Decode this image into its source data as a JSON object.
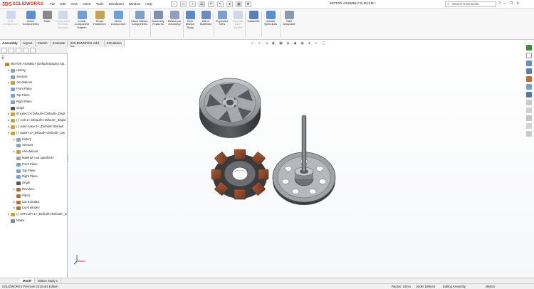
{
  "app": {
    "brand_prefix": "3DS",
    "brand": "SOLIDWORKS"
  },
  "menu": [
    "File",
    "Edit",
    "View",
    "Insert",
    "Tools",
    "Simulation",
    "Window",
    "Help"
  ],
  "document_title": "MOTOR ASSMBLY.SLDASM *",
  "search": {
    "placeholder": "Search Commands"
  },
  "ribbon": [
    {
      "label": "Edit Component",
      "disabled": true,
      "color": "#9bb6d8"
    },
    {
      "label": "Insert Components",
      "disabled": false,
      "color": "#5a8fd0"
    },
    {
      "label": "Mate",
      "disabled": false,
      "color": "#8a8a8a"
    },
    {
      "label": "Component Preview Window",
      "disabled": true,
      "color": "#9bb6d8"
    },
    {
      "label": "Linear Component Pattern",
      "disabled": false,
      "color": "#6f9fd8"
    },
    {
      "label": "Smart Fasteners",
      "disabled": false,
      "color": "#c9a25a"
    },
    {
      "label": "Move Component",
      "disabled": false,
      "color": "#6f9fd8"
    },
    {
      "label": "Show Hidden Components",
      "disabled": false,
      "color": "#7fa0c8"
    },
    {
      "label": "Assembly Features",
      "disabled": false,
      "color": "#7e8fb0"
    },
    {
      "label": "Reference Geometry",
      "disabled": false,
      "color": "#8e9fc0"
    },
    {
      "label": "New Motion Study",
      "disabled": false,
      "color": "#5b8bc8"
    },
    {
      "label": "Bill of Materials",
      "disabled": false,
      "color": "#6a8cc0"
    },
    {
      "label": "Exploded View",
      "disabled": false,
      "color": "#7a9fd0"
    },
    {
      "label": "Explode Line Sketch",
      "disabled": true,
      "color": "#9bb6d8"
    },
    {
      "label": "Instant3D",
      "disabled": false,
      "color": "#5a7fb8"
    },
    {
      "label": "Update Speedpak",
      "disabled": false,
      "color": "#5a8fd0"
    },
    {
      "label": "Take Snapshot",
      "disabled": false,
      "color": "#8a9ab0"
    }
  ],
  "tabs": [
    "Assembly",
    "Layout",
    "Sketch",
    "Evaluate",
    "SOLIDWORKS Add-Ins",
    "Simulation"
  ],
  "tree": [
    {
      "label": "MOTOR ASSMBLY  (Default<Display Sta",
      "level": 0,
      "expander": "",
      "icon": "#c08a2a"
    },
    {
      "label": "History",
      "level": 1,
      "expander": "▸",
      "icon": "#8aa0c0"
    },
    {
      "label": "Sensors",
      "level": 1,
      "expander": "",
      "icon": "#8aa0c0"
    },
    {
      "label": "Annotations",
      "level": 1,
      "expander": "▸",
      "icon": "#c0a040"
    },
    {
      "label": "Front Plane",
      "level": 1,
      "expander": "",
      "icon": "#7aa0d0"
    },
    {
      "label": "Top Plane",
      "level": 1,
      "expander": "",
      "icon": "#7aa0d0"
    },
    {
      "label": "Right Plane",
      "level": 1,
      "expander": "",
      "icon": "#7aa0d0"
    },
    {
      "label": "Origin",
      "level": 1,
      "expander": "",
      "icon": "#555555"
    },
    {
      "label": "(f) axle<1> (Default<<Default>_Displ",
      "level": 1,
      "expander": "▸",
      "icon": "#d0a040"
    },
    {
      "label": "(-) coil<1> (Default<<Default>_Displa",
      "level": 1,
      "expander": "▸",
      "icon": "#d0a040"
    },
    {
      "label": "(-) outer-case<1> (Default<<Default",
      "level": 1,
      "expander": "▸",
      "icon": "#d0a040"
    },
    {
      "label": "(-) stator<1> (Default<<Default>_Dis",
      "level": 1,
      "expander": "▾",
      "icon": "#d0a040"
    },
    {
      "label": "History",
      "level": 2,
      "expander": "▸",
      "icon": "#8aa0c0"
    },
    {
      "label": "Sensors",
      "level": 2,
      "expander": "",
      "icon": "#8aa0c0"
    },
    {
      "label": "Annotations",
      "level": 2,
      "expander": "▸",
      "icon": "#c0a040"
    },
    {
      "label": "Material <not specified>",
      "level": 2,
      "expander": "",
      "icon": "#a0a0a0"
    },
    {
      "label": "Front Plane",
      "level": 2,
      "expander": "",
      "icon": "#7aa0d0"
    },
    {
      "label": "Top Plane",
      "level": 2,
      "expander": "",
      "icon": "#7aa0d0"
    },
    {
      "label": "Right Plane",
      "level": 2,
      "expander": "",
      "icon": "#7aa0d0"
    },
    {
      "label": "Origin",
      "level": 2,
      "expander": "",
      "icon": "#555555"
    },
    {
      "label": "Revolve1",
      "level": 2,
      "expander": "▸",
      "icon": "#b07030"
    },
    {
      "label": "Fillet1",
      "level": 2,
      "expander": "",
      "icon": "#b07030"
    },
    {
      "label": "Cut-Extrude1",
      "level": 2,
      "expander": "▸",
      "icon": "#b07030"
    },
    {
      "label": "Cut-Extrude2",
      "level": 2,
      "expander": "▸",
      "icon": "#b07030"
    },
    {
      "label": "(-) CIRCLIP<1> (Default<<Default>_D",
      "level": 1,
      "expander": "▸",
      "icon": "#d0a040"
    },
    {
      "label": "Mates",
      "level": 1,
      "expander": "",
      "icon": "#808890"
    }
  ],
  "bottom_tabs": [
    "Model",
    "Motion Study 1"
  ],
  "status": {
    "left": "SOLIDWORKS Premium 2018 x64 Edition",
    "radius": "Radius: 10mm",
    "defined": "Under Defined",
    "mode": "Editing Assembly",
    "units": "MMGS"
  },
  "colors": {
    "accent": "#d62b1f",
    "model_gray": "#8a8c90",
    "coil_copper": "#8b4a2b",
    "background": "#ffffff"
  }
}
